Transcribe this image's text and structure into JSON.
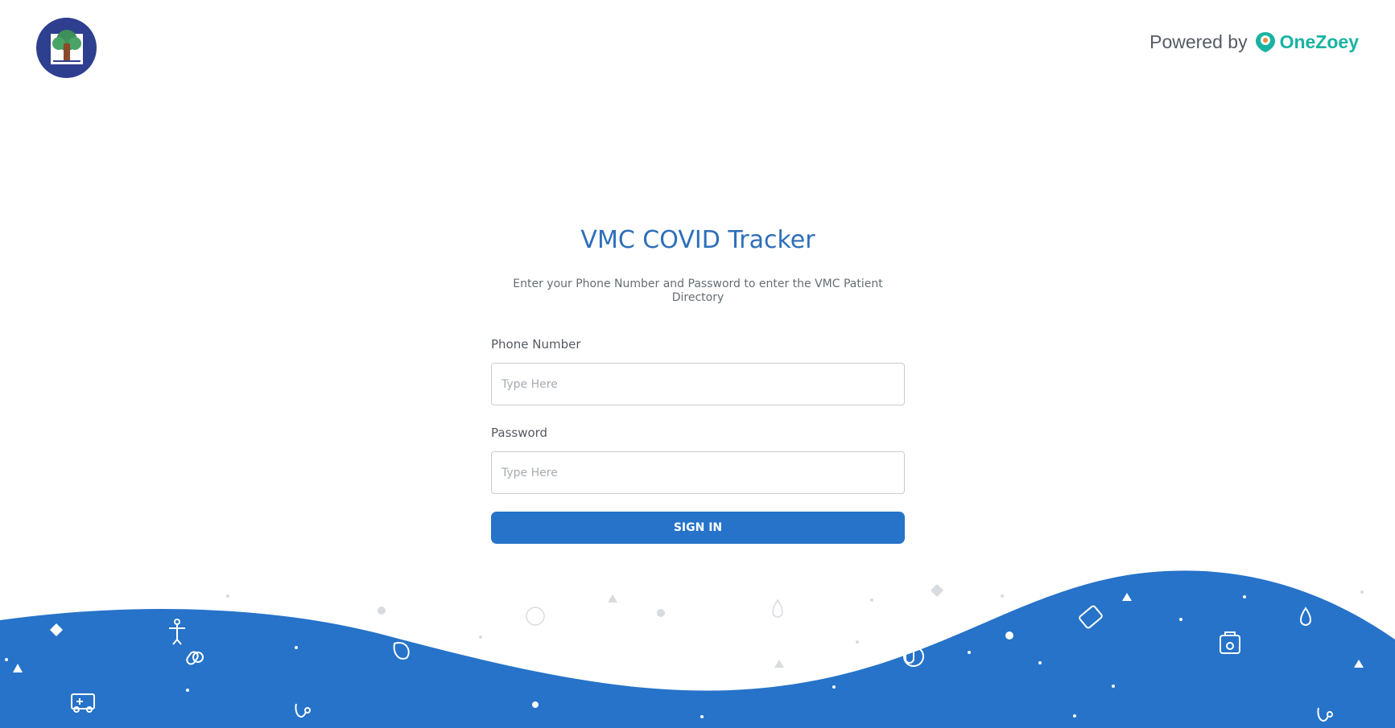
{
  "header": {
    "powered_by_label": "Powered by",
    "brand_name": "OneZoey"
  },
  "login": {
    "title": "VMC COVID Tracker",
    "subtitle": "Enter your Phone Number and Password to enter the VMC Patient Directory",
    "phone_label": "Phone Number",
    "phone_placeholder": "Type Here",
    "password_label": "Password",
    "password_placeholder": "Type Here",
    "signin_label": "SIGN IN"
  },
  "colors": {
    "primary": "#2673c9",
    "title": "#2d6fb9",
    "brand": "#18b3a2",
    "logo_bg": "#2f3f8f"
  },
  "icons": [
    "vmc-logo",
    "onezoey-logo",
    "medical-pattern-icons"
  ]
}
